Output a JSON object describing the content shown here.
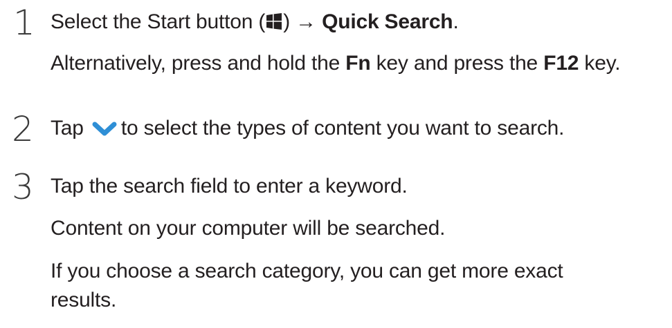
{
  "steps": [
    {
      "number": "1",
      "line1": {
        "before_icon": "Select the Start button (",
        "icon": "windows-logo-icon",
        "after_icon": ") → ",
        "bold": "Quick Search",
        "end": "."
      },
      "line2": {
        "part1": "Alternatively, press and hold the ",
        "key1": "Fn",
        "part2": " key and press the ",
        "key2": "F12",
        "part3": " key."
      }
    },
    {
      "number": "2",
      "line1": {
        "before_icon": "Tap ",
        "icon": "chevron-down-icon",
        "after_icon": "to select the types of content you want to search."
      }
    },
    {
      "number": "3",
      "line1": "Tap the search field to enter a keyword.",
      "line2": "Content on your computer will be searched.",
      "line3": "If you choose a search category, you can get more exact",
      "line4": "results."
    }
  ],
  "colors": {
    "text": "#231f20",
    "step_number": "#3a3a3a",
    "chevron": "#2f8fd6"
  }
}
